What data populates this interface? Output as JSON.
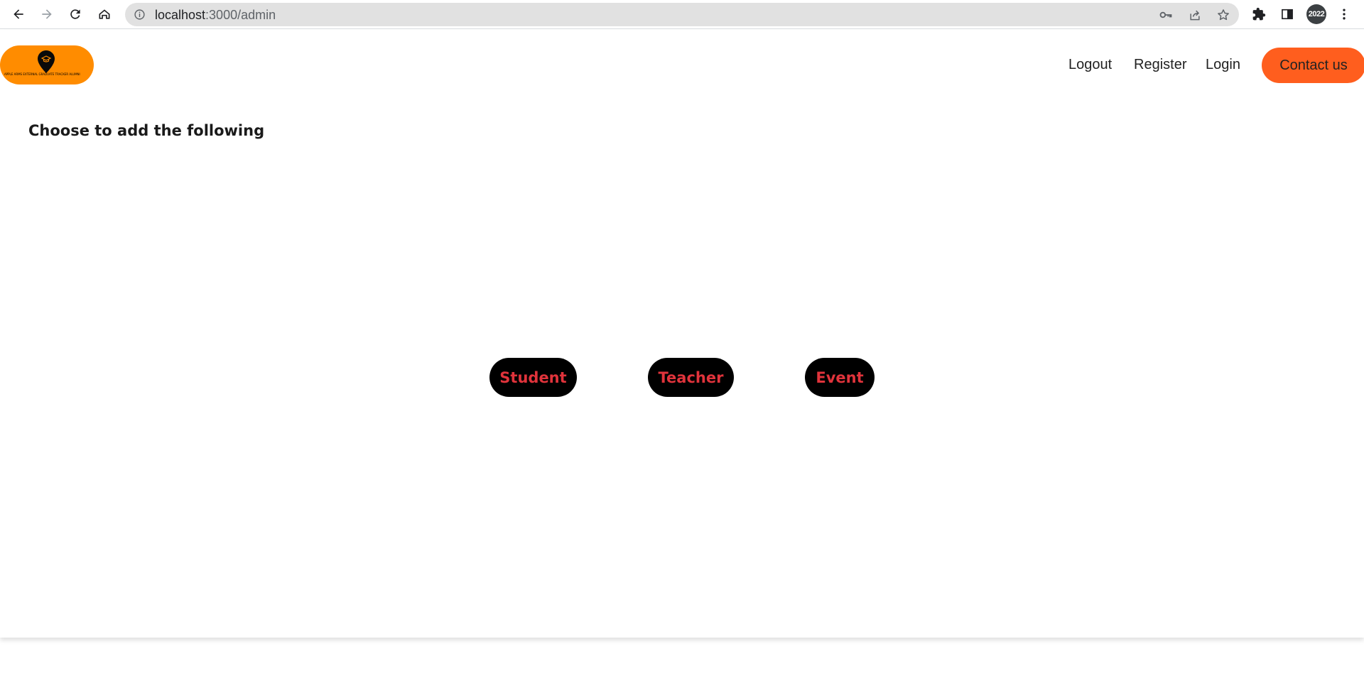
{
  "browser": {
    "url_host": "localhost",
    "url_path": ":3000/admin",
    "profile_label": "2022",
    "icons": [
      "back-icon",
      "forward-icon",
      "reload-icon",
      "home-icon",
      "info-icon",
      "key-icon",
      "share-icon",
      "star-icon",
      "puzzle-icon",
      "side-panel-icon",
      "menu-icon"
    ]
  },
  "header": {
    "logo_text": "APPLE ARMS EXTERNAL GRADUATE TRACKER ALUMNI",
    "nav": {
      "logout": "Logout",
      "register": "Register",
      "login": "Login",
      "contact": "Contact us"
    }
  },
  "main": {
    "heading": "Choose to add the following",
    "buttons": {
      "student": "Student",
      "teacher": "Teacher",
      "event": "Event"
    }
  },
  "colors": {
    "logo_bg": "#ff8c00",
    "contact_bg": "#ff5e1e",
    "action_bg": "#000000",
    "action_text": "#e0333b"
  }
}
